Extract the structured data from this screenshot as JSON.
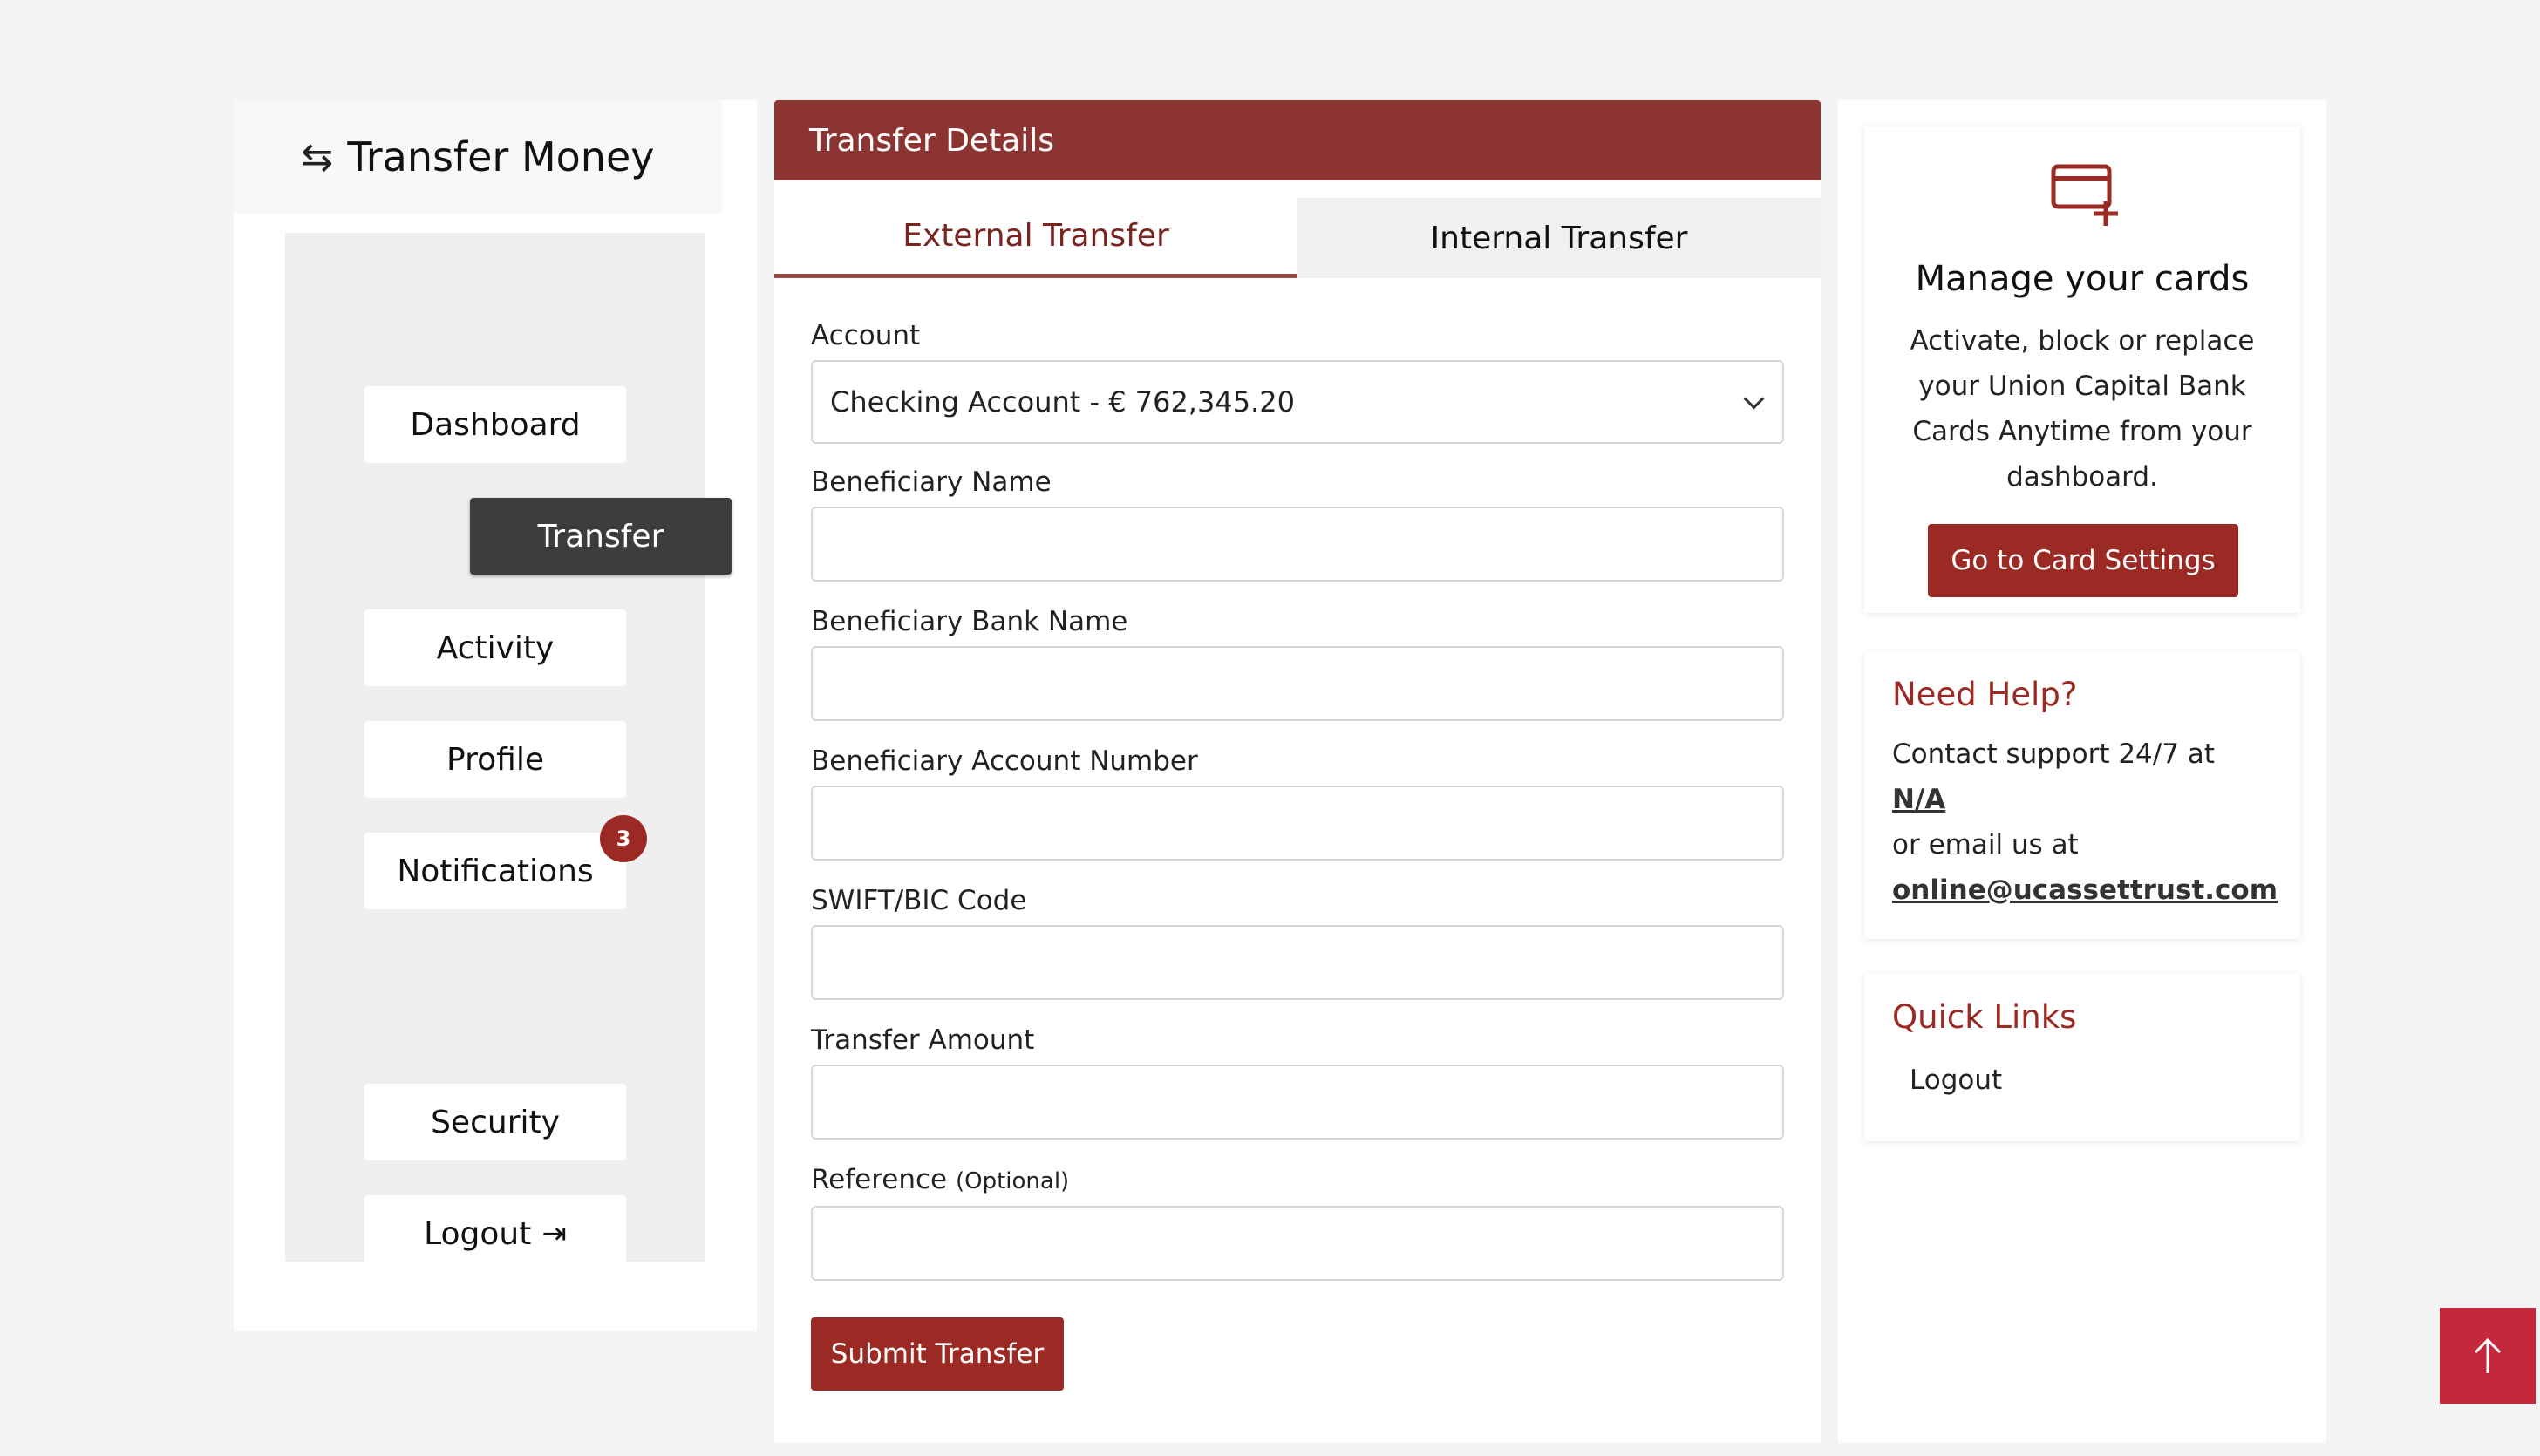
{
  "sidebar": {
    "title": "Transfer Money",
    "title_icon": "transfer-arrows-icon",
    "items": [
      {
        "label": "Dashboard"
      },
      {
        "label": "Transfer"
      },
      {
        "label": "Activity"
      },
      {
        "label": "Profile"
      },
      {
        "label": "Notifications",
        "badge": "3"
      },
      {
        "label": "Security"
      },
      {
        "label": "Logout",
        "icon": "logout-icon"
      }
    ]
  },
  "main": {
    "header": "Transfer Details",
    "tabs": [
      {
        "label": "External Transfer",
        "active": true
      },
      {
        "label": "Internal Transfer",
        "active": false
      }
    ],
    "account": {
      "label": "Account",
      "selected": "Checking Account - € 762,345.20"
    },
    "fields": [
      {
        "label": "Beneficiary Name",
        "value": "",
        "placeholder": ""
      },
      {
        "label": "Beneficiary Bank Name",
        "value": "",
        "placeholder": ""
      },
      {
        "label": "Beneficiary Account Number",
        "value": "",
        "placeholder": ""
      },
      {
        "label": "SWIFT/BIC Code",
        "value": "",
        "placeholder": ""
      },
      {
        "label": "Transfer Amount",
        "value": "",
        "placeholder": ""
      },
      {
        "label": "Reference",
        "optional": "(Optional)",
        "value": "",
        "placeholder": ""
      }
    ],
    "submit_label": "Submit Transfer"
  },
  "right": {
    "cards": {
      "icon": "credit-card-add-icon",
      "title": "Manage your cards",
      "text": "Activate, block or replace your Union Capital Bank Cards Anytime from your dashboard.",
      "button": "Go to Card Settings"
    },
    "help": {
      "title": "Need Help?",
      "line1": "Contact support 24/7 at",
      "phone": "N/A",
      "line2": "or email us at",
      "email": "online@ucassettrust.com"
    },
    "links": {
      "title": "Quick Links",
      "items": [
        "Logout"
      ]
    }
  },
  "scroll_top": {
    "icon": "arrow-up-icon"
  },
  "colors": {
    "brand": "#9b2a24",
    "header": "#8b3431",
    "nav_active": "#3d3d3d",
    "scroll_top": "#c5283d"
  }
}
